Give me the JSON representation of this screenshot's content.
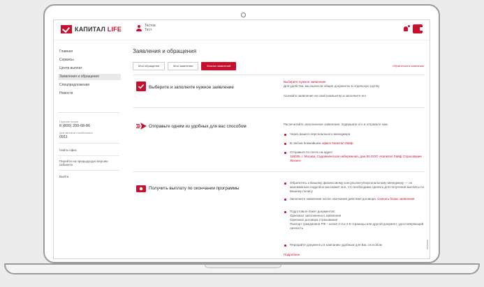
{
  "logo": {
    "brand_text_a": "КАПИТАЛ ",
    "brand_text_b": "LIFE"
  },
  "user": {
    "line1": "Тестов",
    "line2": "Тест"
  },
  "sidebar": {
    "items": [
      {
        "label": "Главная"
      },
      {
        "label": "Сервисы"
      },
      {
        "label": "Центр выплат"
      },
      {
        "label": "Заявления и обращения",
        "active": true
      },
      {
        "label": "Спецпредложения"
      },
      {
        "label": "Новости"
      }
    ],
    "hotline_label": "Горячая линия",
    "hotline_phone": "8 (800) 200-68-86",
    "mobile_label": "Для звонков с мобильных",
    "mobile_number": "0911",
    "office_link": "Найти офис",
    "old_version_link": "Перейти на предыдущую версию кабинета",
    "logout": "Выйти"
  },
  "main": {
    "title": "Заявления и обращения",
    "tabs": [
      {
        "label": "Мои обращения"
      },
      {
        "label": "Мои заявления"
      },
      {
        "label": "Бланки заявлений",
        "active": true
      }
    ],
    "contact_link": "Обратиться в компанию",
    "step1": {
      "title": "Выберите и заполните нужное заявление",
      "link": "Выберите нужное заявление",
      "text1": "Для удобства, мы вынесли общие документы в отдельную группу",
      "text2": "Скачайте заявление на свой компьютер и заполните его"
    },
    "step2": {
      "title": "Отправьте одним из удобных для вас способом",
      "intro": "Распечатайте заполненное заявление, подпишите его и отправьте нам:",
      "b1": "Через вашего персонального менеджера",
      "b2a": "В любом ближайшем ",
      "b2b": "офисе Капитал Лайф",
      "b3a": "Отправьте по почте на адрес:",
      "b3b": "115035, г. Москва, Садовническая набережная, дом 50 ООО «Капитал Лайф Страхование Жизни»"
    },
    "step3": {
      "title": "Получить выплату по окончании программы",
      "b1": "Обратитесь к Вашему финансовому консультанту/персональному менеджеру — он максимально подробно расскажет все, что необходимо сделать для получения выплаты по Вашему полису",
      "b2a": "Заполните заявление после окончания действия договора. ",
      "b2b": "Скачать бланк заявления",
      "b3a": "Подготовьте пакет документов:",
      "b3b": "Оригинал заполненного заявления",
      "b3c": "Оригинал договора страхования",
      "b3d": "Паспорт гражданина РФ – копия 2-3 и 4-5 страницы или другой документ, удостоверяющий личность",
      "b4": "Передайте документы в компанию удобным для Вас способом",
      "more": "Подробнее"
    }
  },
  "colors": {
    "brand_red": "#c8102e"
  }
}
